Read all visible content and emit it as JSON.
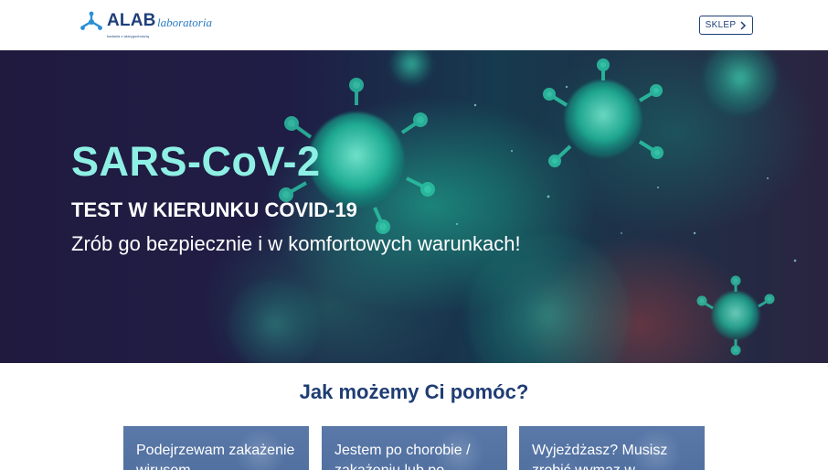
{
  "header": {
    "logo": {
      "brand": "ALAB",
      "sub": "laboratoria",
      "tagline": "badania z wiarygodnością"
    },
    "shop_label": "SKLEP",
    "shop_icon": "chevron-right-icon"
  },
  "hero": {
    "title": "SARS-CoV-2",
    "subtitle": "TEST W KIERUNKU COVID-19",
    "tagline": "Zrób go bezpiecznie i w komfortowych warunkach!"
  },
  "help": {
    "title": "Jak możemy Ci pomóc?",
    "cards": [
      {
        "title": "Podejrzewam zakażenie wirusem"
      },
      {
        "title": "Jestem po chorobie / zakażeniu lub po"
      },
      {
        "title": "Wyjeżdżasz? Musisz zrobić wymaz w"
      }
    ]
  },
  "colors": {
    "brand_navy": "#1e3f7a",
    "accent_teal": "#8ef0e4",
    "card_blue": "#5a78a8"
  }
}
